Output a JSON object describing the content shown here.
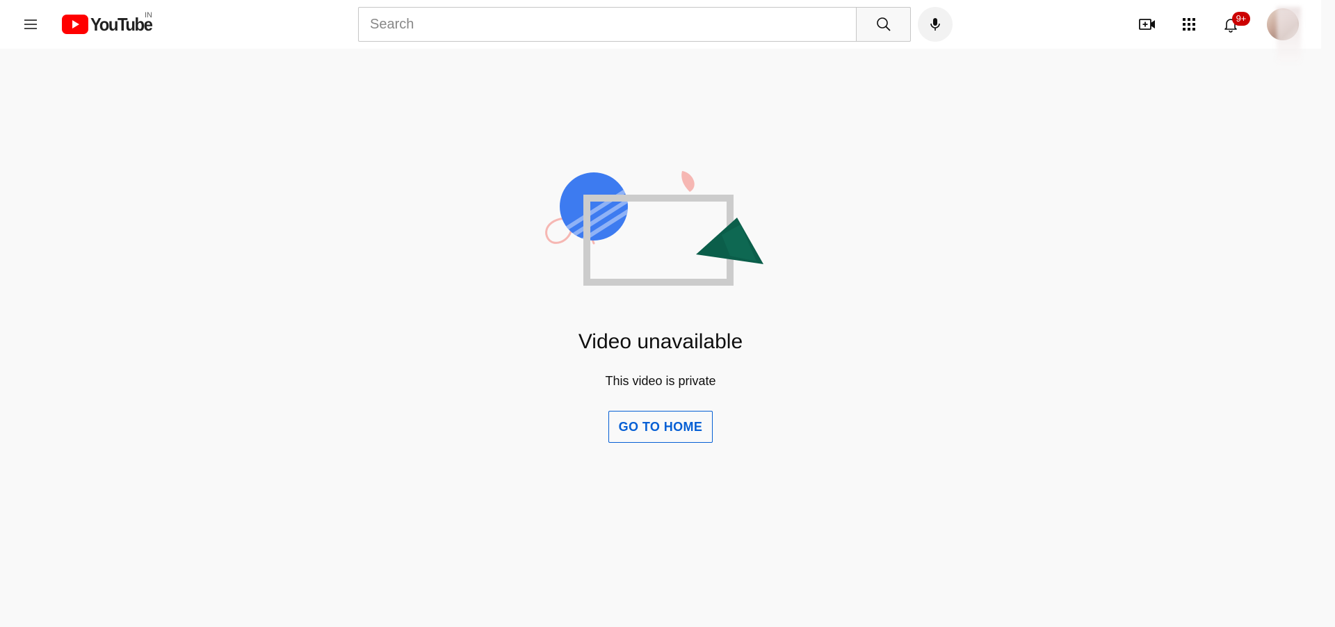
{
  "header": {
    "logo_text": "YouTube",
    "country_code": "IN",
    "search": {
      "placeholder": "Search",
      "value": ""
    },
    "notifications": {
      "badge": "9+"
    },
    "icons": [
      "menu-icon",
      "youtube-logo-icon",
      "search-icon",
      "mic-icon",
      "create-video-icon",
      "apps-grid-icon",
      "bell-icon"
    ]
  },
  "error": {
    "title": "Video unavailable",
    "subtitle": "This video is private",
    "home_button_label": "GO TO HOME"
  },
  "colors": {
    "brand_red": "#ff0000",
    "link_blue": "#065fd4",
    "badge_red": "#cc0000",
    "page_background": "#f9f9f9",
    "illustration_blue": "#3d7bf0",
    "illustration_green": "#0b5e4a",
    "illustration_pink": "#f6b7b3",
    "illustration_frame": "#cccccc"
  }
}
